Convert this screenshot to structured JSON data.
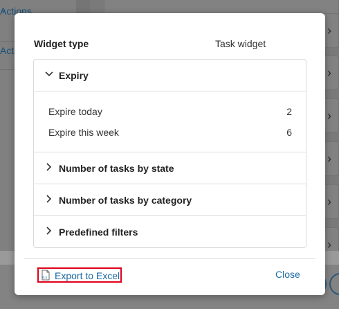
{
  "background": {
    "left_items": [
      {
        "label": "Actions"
      },
      {
        "label": "Acti"
      }
    ]
  },
  "modal": {
    "widget_type_label": "Widget type",
    "widget_type_value": "Task widget",
    "sections": [
      {
        "title": "Expiry",
        "expanded": true,
        "rows": [
          {
            "label": "Expire today",
            "value": "2"
          },
          {
            "label": "Expire this week",
            "value": "6"
          }
        ]
      },
      {
        "title": "Number of tasks by state",
        "expanded": false
      },
      {
        "title": "Number of tasks by category",
        "expanded": false
      },
      {
        "title": "Predefined filters",
        "expanded": false
      }
    ],
    "export_label": "Export to Excel",
    "export_icon_text": "XLS",
    "close_label": "Close"
  },
  "colors": {
    "link": "#1b6aa5",
    "highlight_border": "#e0001a"
  }
}
